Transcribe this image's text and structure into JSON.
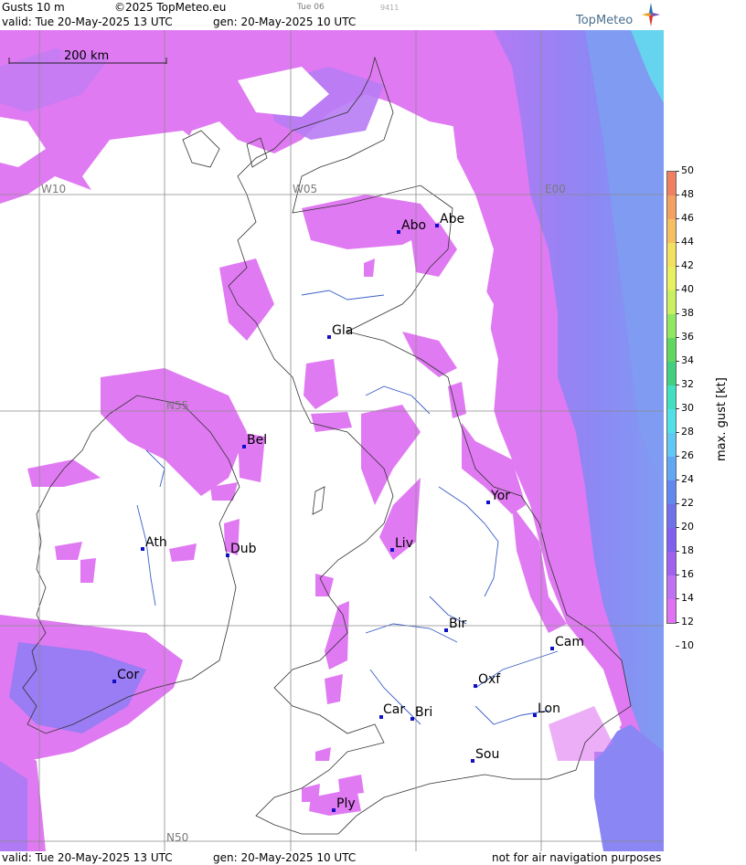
{
  "header": {
    "title": "Gusts 10 m",
    "copyright": "©2025 TopMeteo.eu",
    "day_tag": "Tue 06",
    "code": "9411",
    "valid": "valid:  Tue  20-May-2025  13 UTC",
    "gen": "gen: 20-May-2025 10 UTC",
    "brand": "TopMeteo"
  },
  "footer": {
    "valid": "valid:  Tue  20-May-2025  13 UTC",
    "gen": "gen: 20-May-2025 10 UTC",
    "disclaimer": "not for air navigation purposes"
  },
  "scale_bar": "200 km",
  "grid_labels": {
    "w10": "W10",
    "w05": "W05",
    "e00": "E00",
    "n55": "N55",
    "n50": "N50"
  },
  "cities": {
    "abo": "Abo",
    "abe": "Abe",
    "gla": "Gla",
    "bel": "Bel",
    "yor": "Yor",
    "ath": "Ath",
    "dub": "Dub",
    "liv": "Liv",
    "bir": "Bir",
    "cam": "Cam",
    "cor": "Cor",
    "oxf": "Oxf",
    "car": "Car",
    "bri": "Bri",
    "lon": "Lon",
    "sou": "Sou",
    "ply": "Ply"
  },
  "legend": {
    "title": "max. gust [kt]",
    "values": [
      "50",
      "48",
      "46",
      "44",
      "42",
      "40",
      "38",
      "36",
      "34",
      "32",
      "30",
      "28",
      "26",
      "24",
      "22",
      "20",
      "18",
      "16",
      "14",
      "12",
      "10"
    ],
    "colors": [
      "#f08060",
      "#f4a060",
      "#f6c060",
      "#f4e060",
      "#e8f060",
      "#c8f060",
      "#90e860",
      "#60d860",
      "#40d080",
      "#40e0c0",
      "#50e0e8",
      "#60c8f4",
      "#60a8f4",
      "#6088f0",
      "#7070ec",
      "#8060f0",
      "#a060f0",
      "#c070f4",
      "#e070f4"
    ]
  },
  "colors": {
    "magenta": "#e07af2",
    "violet": "#b07af4",
    "blue": "#8a86f4",
    "cyan": "#66d4ee"
  }
}
